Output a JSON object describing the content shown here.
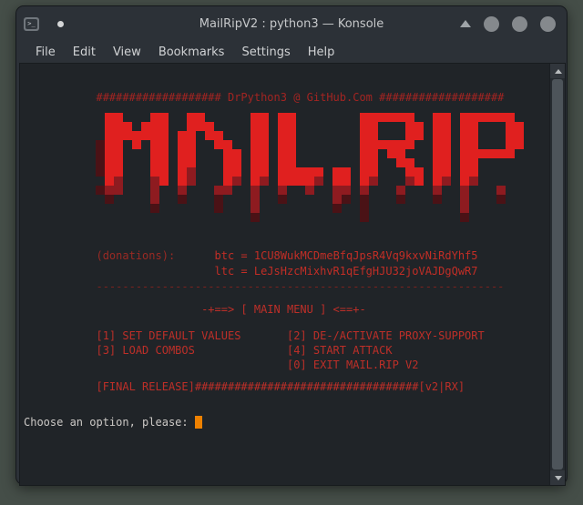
{
  "window": {
    "title": "MailRipV2 : python3 — Konsole"
  },
  "menubar": {
    "items": [
      "File",
      "Edit",
      "View",
      "Bookmarks",
      "Settings",
      "Help"
    ]
  },
  "terminal": {
    "lines": {
      "hash_header": "           ################### DrPython3 @ GitHub.Com ###################",
      "donations_label": "           (donations):",
      "donations_value": "      btc = 1CU8WukMCDmeBfqJpsR4Vq9kxvNiRdYhf5",
      "ltc_line": "                             ltc = LeJsHzcMixhvR1qEfgHJU32joVAJDgQwR7",
      "separator": "           --------------------------------------------------------------",
      "menu_title": "                           -+==> [ MAIN MENU ] <==+-",
      "menu_row1": "           [1] SET DEFAULT VALUES       [2] DE-/ACTIVATE PROXY-SUPPORT",
      "menu_row2": "           [3] LOAD COMBOS              [4] START ATTACK",
      "menu_row3": "                                        [0] EXIT MAIL.RIP V2",
      "final_release": "           [FINAL RELEASE]##################################[v2|RX]",
      "prompt": "Choose an option, please: "
    },
    "colors": {
      "background": "#202428",
      "hash_red": "#a32422",
      "label_red": "#9a2a24",
      "address_red": "#c22e26",
      "separator_red": "#7c221e",
      "menu_red": "#bd2f28",
      "prompt_text": "#ccc9c6",
      "cursor_orange": "#ee8100"
    }
  },
  "art": {
    "text": "MAIL.RIP",
    "cell": 10,
    "shades": {
      "0": "#4a1216",
      "1": "#8e1b20",
      "2": "#e0201f",
      "3": "#ef4448"
    },
    "rows": [
      [
        [
          1,
          "22"
        ],
        [
          6,
          "22"
        ],
        [
          10,
          "22"
        ],
        [
          17,
          "22"
        ],
        [
          20,
          "22"
        ],
        [
          29,
          "222222"
        ],
        [
          37,
          "22"
        ],
        [
          40,
          "222222"
        ]
      ],
      [
        [
          1,
          "222"
        ],
        [
          5,
          "222"
        ],
        [
          10,
          "222"
        ],
        [
          17,
          "22"
        ],
        [
          20,
          "22"
        ],
        [
          29,
          "22"
        ],
        [
          34,
          "22"
        ],
        [
          37,
          "22"
        ],
        [
          40,
          "22"
        ],
        [
          45,
          "22"
        ]
      ],
      [
        [
          1,
          "2222222"
        ],
        [
          9,
          "22"
        ],
        [
          12,
          "22"
        ],
        [
          17,
          "22"
        ],
        [
          20,
          "22"
        ],
        [
          29,
          "22"
        ],
        [
          34,
          "22"
        ],
        [
          37,
          "22"
        ],
        [
          40,
          "22"
        ],
        [
          45,
          "22"
        ]
      ],
      [
        [
          0,
          "0"
        ],
        [
          1,
          "22"
        ],
        [
          4,
          "2"
        ],
        [
          6,
          "22"
        ],
        [
          9,
          "22"
        ],
        [
          13,
          "22"
        ],
        [
          17,
          "22"
        ],
        [
          20,
          "22"
        ],
        [
          29,
          "222222"
        ],
        [
          37,
          "22"
        ],
        [
          40,
          "22"
        ],
        [
          45,
          "22"
        ]
      ],
      [
        [
          0,
          "0"
        ],
        [
          1,
          "22"
        ],
        [
          6,
          "22"
        ],
        [
          9,
          "22"
        ],
        [
          14,
          "22"
        ],
        [
          17,
          "22"
        ],
        [
          20,
          "22"
        ],
        [
          29,
          "22"
        ],
        [
          32,
          "22"
        ],
        [
          37,
          "22"
        ],
        [
          40,
          "222222"
        ]
      ],
      [
        [
          0,
          "0"
        ],
        [
          1,
          "22"
        ],
        [
          6,
          "22"
        ],
        [
          9,
          "22"
        ],
        [
          14,
          "22"
        ],
        [
          17,
          "22"
        ],
        [
          20,
          "22"
        ],
        [
          29,
          "22"
        ],
        [
          33,
          "22"
        ],
        [
          37,
          "22"
        ],
        [
          40,
          "22"
        ]
      ],
      [
        [
          0,
          "0"
        ],
        [
          1,
          "22"
        ],
        [
          6,
          "22"
        ],
        [
          9,
          "21"
        ],
        [
          14,
          "22"
        ],
        [
          17,
          "22"
        ],
        [
          20,
          "22222"
        ],
        [
          26,
          "22"
        ],
        [
          29,
          "22"
        ],
        [
          34,
          "22"
        ],
        [
          37,
          "22"
        ],
        [
          40,
          "22"
        ]
      ],
      [
        [
          1,
          "21"
        ],
        [
          6,
          "12"
        ],
        [
          9,
          "21"
        ],
        [
          14,
          "21"
        ],
        [
          17,
          "21"
        ],
        [
          20,
          "22221"
        ],
        [
          26,
          "22"
        ],
        [
          29,
          "21"
        ],
        [
          34,
          "12"
        ],
        [
          37,
          "21"
        ],
        [
          40,
          "21"
        ]
      ],
      [
        [
          0,
          "0"
        ],
        [
          1,
          "11"
        ],
        [
          6,
          "1"
        ],
        [
          9,
          "1"
        ],
        [
          13,
          "11"
        ],
        [
          17,
          "1"
        ],
        [
          20,
          "1"
        ],
        [
          23,
          "1"
        ],
        [
          26,
          "11"
        ],
        [
          29,
          "1"
        ],
        [
          33,
          "1"
        ],
        [
          37,
          "1"
        ],
        [
          40,
          "1"
        ],
        [
          44,
          "1"
        ]
      ],
      [
        [
          1,
          "0"
        ],
        [
          6,
          "1"
        ],
        [
          9,
          "0"
        ],
        [
          13,
          "0"
        ],
        [
          17,
          "1"
        ],
        [
          20,
          "0"
        ],
        [
          26,
          "10"
        ],
        [
          29,
          "0"
        ],
        [
          33,
          "0"
        ],
        [
          37,
          "0"
        ],
        [
          40,
          "1"
        ],
        [
          44,
          "0"
        ]
      ],
      [
        [
          6,
          "0"
        ],
        [
          13,
          "0"
        ],
        [
          17,
          "1"
        ],
        [
          26,
          "0"
        ],
        [
          29,
          "0"
        ],
        [
          40,
          "1"
        ]
      ],
      [
        [
          17,
          "0"
        ],
        [
          29,
          "0"
        ],
        [
          40,
          "0"
        ]
      ]
    ]
  }
}
